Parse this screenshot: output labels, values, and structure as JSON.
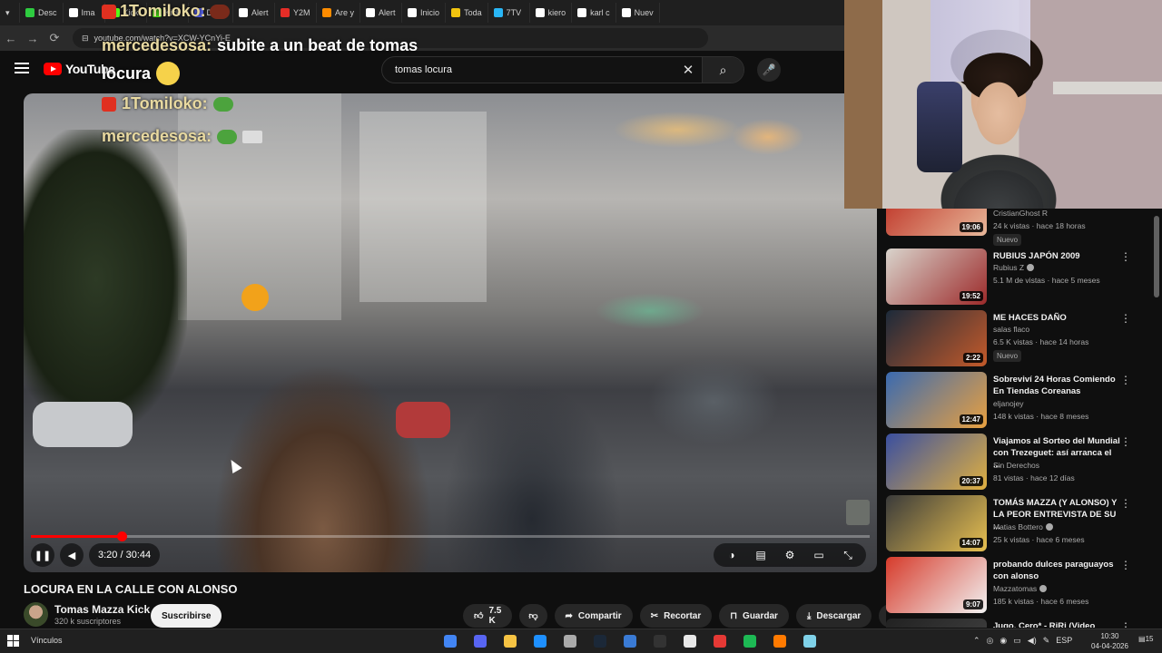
{
  "browser": {
    "tabs": [
      {
        "label": "Desc",
        "color": "#2ecc40"
      },
      {
        "label": "Ima",
        "color": "#ffffff"
      },
      {
        "label": "Kick",
        "color": "#53fc18"
      },
      {
        "label": "Kick",
        "color": "#53fc18"
      },
      {
        "label": "Disco",
        "color": "#5865f2"
      },
      {
        "label": "Alert",
        "color": "#ffffff"
      },
      {
        "label": "Y2M",
        "color": "#e52d27"
      },
      {
        "label": "Are y",
        "color": "#ff8c00"
      },
      {
        "label": "Alert",
        "color": "#ffffff"
      },
      {
        "label": "Inicio",
        "color": "#ffffff"
      },
      {
        "label": "Toda",
        "color": "#f1c40f"
      },
      {
        "label": "7TV",
        "color": "#29b6f6"
      },
      {
        "label": "kiero",
        "color": "#ffffff"
      },
      {
        "label": "karl c",
        "color": "#ffffff"
      },
      {
        "label": "Nuev",
        "color": "#ffffff"
      }
    ],
    "url": "youtube.com/watch?v=XCW-YCnYi-E"
  },
  "youtube": {
    "logo_text": "YouTube",
    "search_query": "tomas locura",
    "search_icon": "search-icon",
    "mic_icon": "mic-icon"
  },
  "chat_overlay": {
    "lines": [
      {
        "user": "1Tomiloko:",
        "msg": "",
        "badge": "kick-badge"
      },
      {
        "user": "mercedesosa:",
        "msg": "subite a un beat de tomas"
      },
      {
        "user": "",
        "msg": "locura"
      },
      {
        "user": "1Tomiloko:",
        "msg": "",
        "badge": "kick-badge"
      },
      {
        "user": "mercedesosa:",
        "msg": ""
      }
    ]
  },
  "player": {
    "current_time": "3:20",
    "total_time": "30:44",
    "time_display": "3:20 / 30:44",
    "progress": 0.108
  },
  "video": {
    "title": "LOCURA EN LA CALLE CON ALONSO",
    "channel": "Tomas Mazza Kick",
    "subscribers": "320 k suscriptores",
    "subscribe_label": "Suscribirse",
    "likes": "7.5 K",
    "share_label": "Compartir",
    "clip_label": "Recortar",
    "save_label": "Guardar",
    "download_label": "Descargar"
  },
  "recommendations": [
    {
      "title": "",
      "channel": "CristianGhost R",
      "meta": "24 k vistas · hace 18 horas",
      "duration": "19:06",
      "badge": "Nuevo",
      "verified": false,
      "colors": [
        "#c0392b",
        "#e8b89a"
      ]
    },
    {
      "title": "RUBIUS JAPÓN 2009",
      "channel": "Rubius Z",
      "meta": "5.1 M de vistas · hace 5 meses",
      "duration": "19:52",
      "badge": "",
      "verified": true,
      "colors": [
        "#d9d4cc",
        "#9c2a2a"
      ]
    },
    {
      "title": "ME HACES DAÑO",
      "channel": "salas flaco",
      "meta": "6.5 K vistas · hace 14 horas",
      "duration": "2:22",
      "badge": "Nuevo",
      "verified": false,
      "colors": [
        "#1c2a3a",
        "#c45a2a"
      ]
    },
    {
      "title": "Sobreviví 24 Horas Comiendo En Tiendas Coreanas",
      "channel": "eljanojey",
      "meta": "148 k vistas · hace 8 meses",
      "duration": "12:47",
      "badge": "",
      "verified": false,
      "colors": [
        "#3a6ab0",
        "#e8a040"
      ]
    },
    {
      "title": "Viajamos al Sorteo del Mundial con Trezeguet: así arranca el ...",
      "channel": "Sin Derechos",
      "meta": "81 vistas · hace 12 días",
      "duration": "20:37",
      "badge": "",
      "verified": false,
      "colors": [
        "#3a4fa0",
        "#e0b040"
      ]
    },
    {
      "title": "TOMÁS MAZZA (Y ALONSO) Y LA PEOR ENTREVISTA DE SU ...",
      "channel": "Matias Bottero",
      "meta": "25 k vistas · hace 6 meses",
      "duration": "14:07",
      "badge": "",
      "verified": true,
      "colors": [
        "#3a3a3a",
        "#e8c050"
      ]
    },
    {
      "title": "probando dulces paraguayos con alonso",
      "channel": "Mazzatomas",
      "meta": "185 k vistas · hace 6 meses",
      "duration": "9:07",
      "badge": "",
      "verified": true,
      "colors": [
        "#d63a2a",
        "#f2f2f2"
      ]
    },
    {
      "title": "Jugo, Cero* - RiRi (Video",
      "channel": "",
      "meta": "",
      "duration": "",
      "badge": "",
      "verified": false,
      "colors": [
        "#222",
        "#444"
      ]
    }
  ],
  "taskbar": {
    "links_label": "Vínculos",
    "lang": "ESP",
    "time": "10:30",
    "date": "04-04-2026",
    "notifications": "15",
    "apps": [
      "#4285f4",
      "#5865f2",
      "#f6c343",
      "#1e90ff",
      "#aaaaaa",
      "#1b2838",
      "#3a7bd5",
      "#333333",
      "#e8e8e8",
      "#e53935",
      "#1db954",
      "#ff7a00",
      "#7fd1e8"
    ]
  }
}
